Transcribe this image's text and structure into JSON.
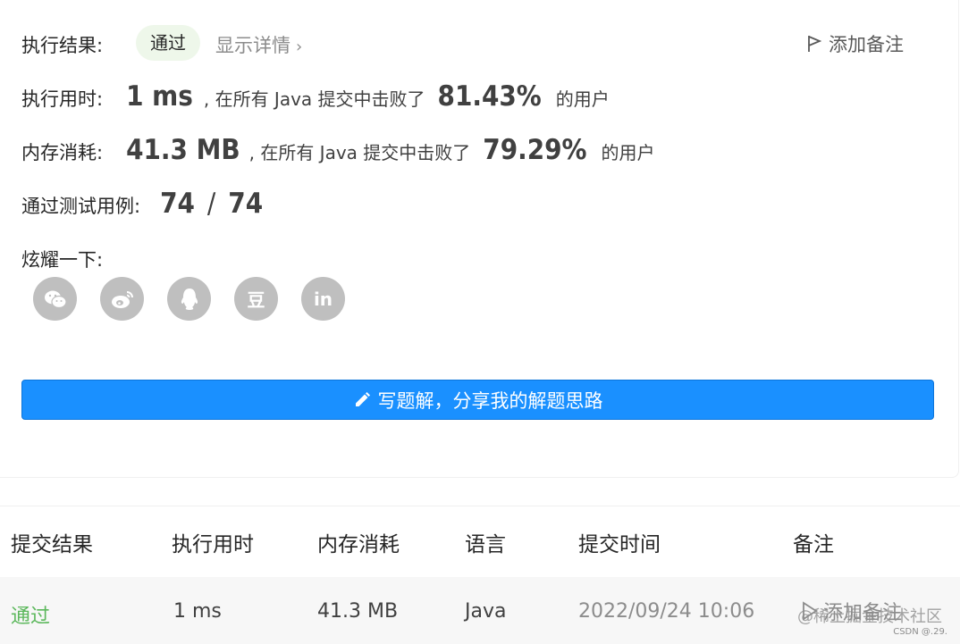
{
  "result": {
    "label": "执行结果:",
    "status": "通过",
    "details": "显示详情",
    "add_note": "添加备注"
  },
  "runtime": {
    "label": "执行用时:",
    "value": "1 ms",
    "prefix": ", 在所有 Java 提交中击败了",
    "percent": "81.43%",
    "suffix": "的用户"
  },
  "memory": {
    "label": "内存消耗:",
    "value": "41.3 MB",
    "prefix": ", 在所有 Java 提交中击败了",
    "percent": "79.29%",
    "suffix": "的用户"
  },
  "tests": {
    "label": "通过测试用例:",
    "passed": "74",
    "sep": "/",
    "total": "74"
  },
  "share": {
    "label": "炫耀一下:",
    "icons": [
      "wechat-icon",
      "weibo-icon",
      "qq-icon",
      "douban-icon",
      "linkedin-icon"
    ],
    "linkedin_text": "in",
    "douban_text": "豆"
  },
  "write_button": "写题解，分享我的解题思路",
  "table": {
    "headers": [
      "提交结果",
      "执行用时",
      "内存消耗",
      "语言",
      "提交时间",
      "备注"
    ],
    "rows": [
      {
        "status": "通过",
        "runtime": "1 ms",
        "memory": "41.3 MB",
        "language": "Java",
        "time": "2022/09/24 10:06",
        "note": "添加备注"
      }
    ]
  },
  "watermark": "@稀土掘金技术社区",
  "csdn": "CSDN @.29.",
  "colors": {
    "accent": "#1a90ff",
    "success": "#5cb85c",
    "pill_bg": "#eef7ea",
    "icon_gray": "#bfbfbf"
  }
}
